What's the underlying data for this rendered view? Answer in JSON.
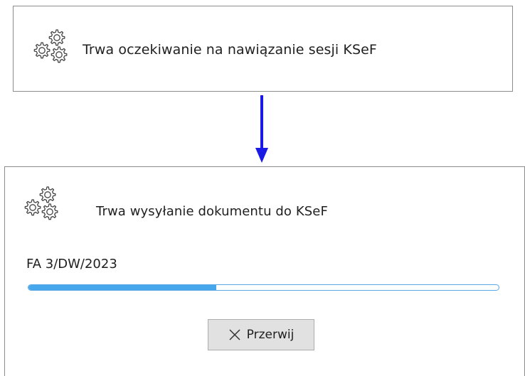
{
  "dialog_1": {
    "status_text": "Trwa oczekiwanie na nawiązanie sesji KSeF",
    "icon": "gears-icon"
  },
  "dialog_2": {
    "status_text": "Trwa wysyłanie dokumentu do KSeF",
    "icon": "gears-icon",
    "document_number": "FA 3/DW/2023",
    "progress_percent": 40,
    "abort_button_label": "Przerwij",
    "abort_icon": "close-icon"
  },
  "colors": {
    "progress_fill": "#46a7ec",
    "progress_border": "#5aa9e6",
    "arrow": "#1a1ae6",
    "button_bg": "#e1e1e1"
  }
}
